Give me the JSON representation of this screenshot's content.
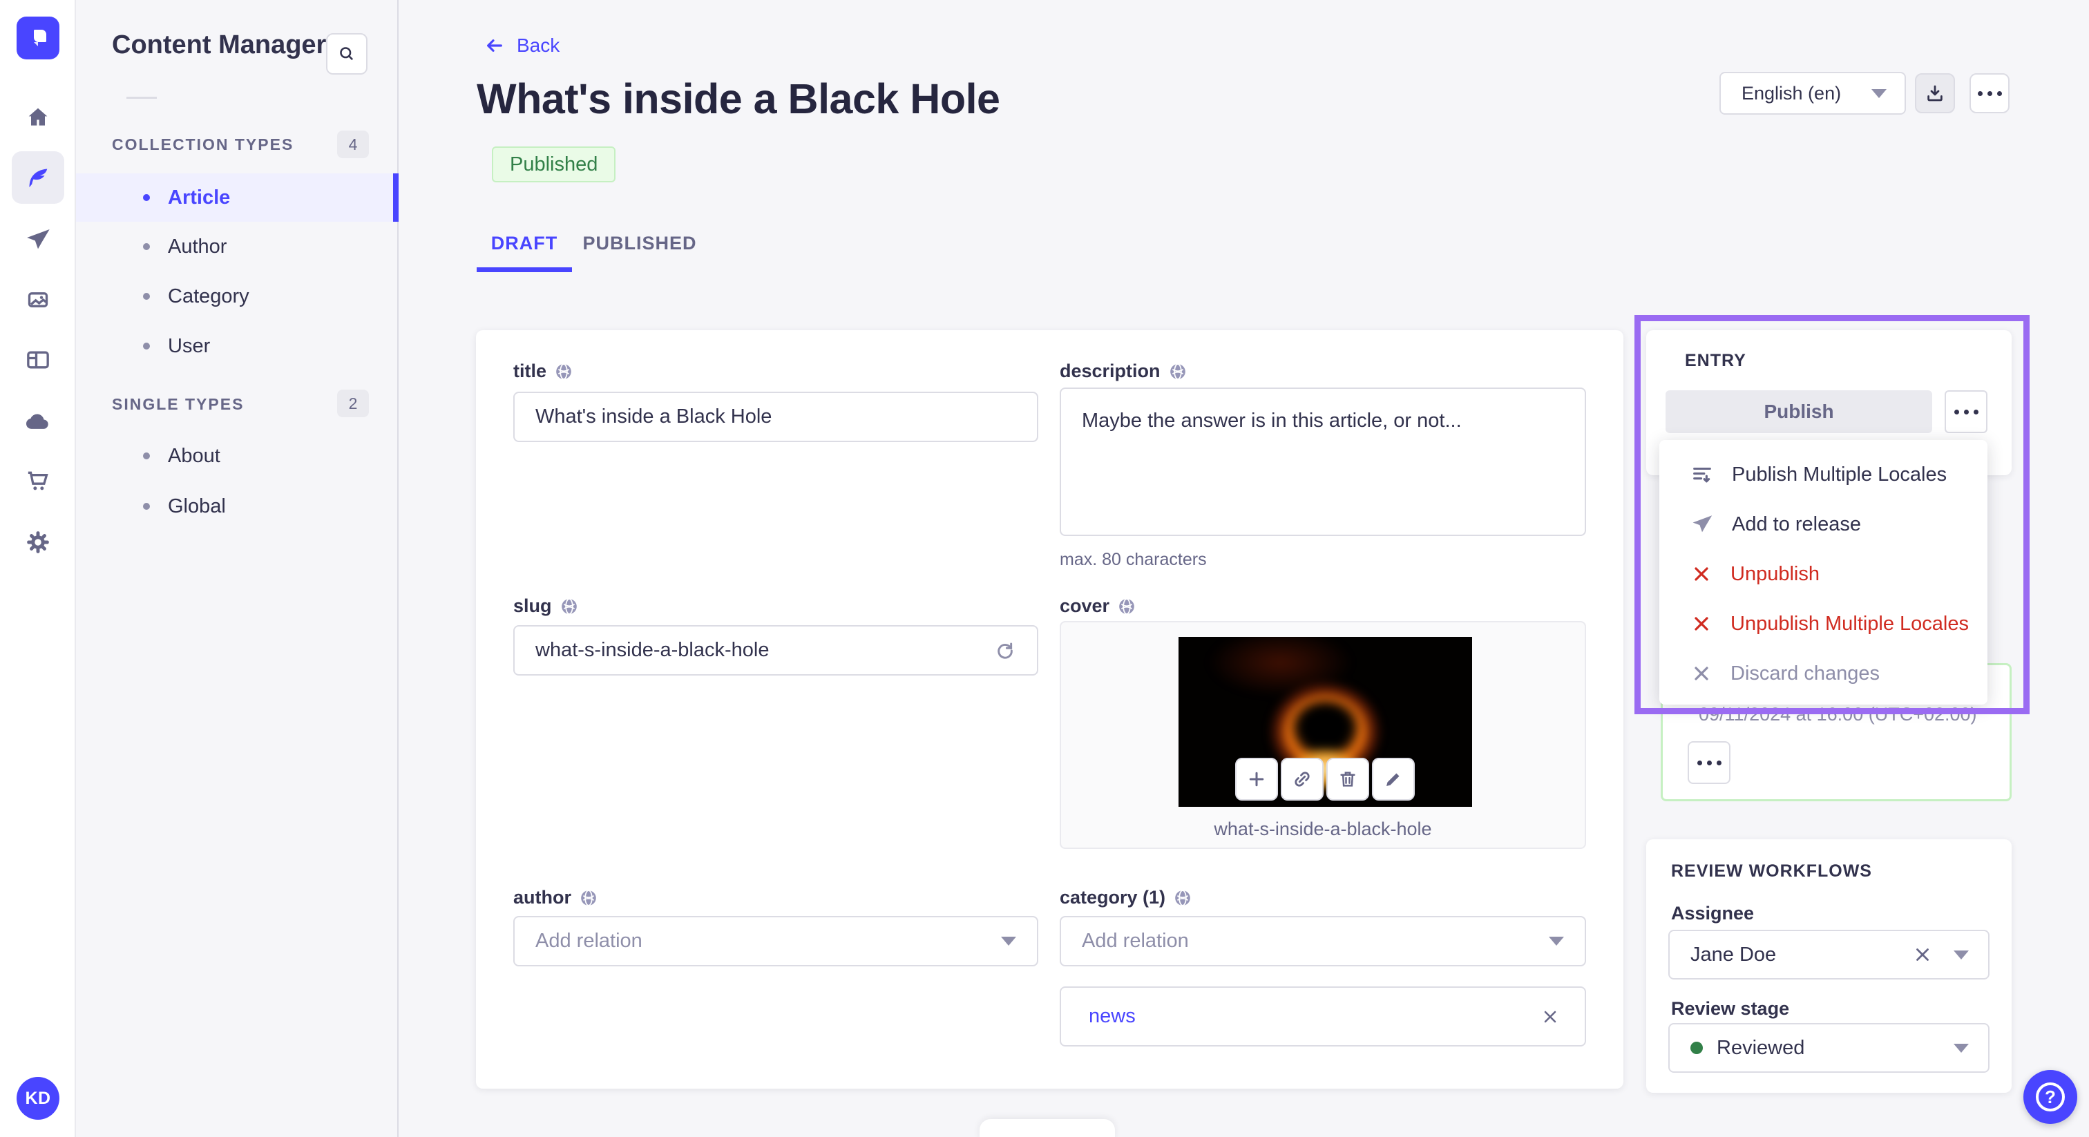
{
  "subnav": {
    "title": "Content Manager",
    "sections": [
      {
        "label": "COLLECTION TYPES",
        "count": "4",
        "items": [
          {
            "label": "Article"
          },
          {
            "label": "Author"
          },
          {
            "label": "Category"
          },
          {
            "label": "User"
          }
        ]
      },
      {
        "label": "SINGLE TYPES",
        "count": "2",
        "items": [
          {
            "label": "About"
          },
          {
            "label": "Global"
          }
        ]
      }
    ]
  },
  "header": {
    "back_label": "Back",
    "title": "What's inside a Black Hole",
    "status_badge": "Published",
    "locale_selected": "English (en)"
  },
  "tabs": {
    "draft": "DRAFT",
    "published": "PUBLISHED"
  },
  "form": {
    "title_field": {
      "label": "title",
      "value": "What's inside a Black Hole"
    },
    "description_field": {
      "label": "description",
      "value": "Maybe the answer is in this article, or not...",
      "hint": "max. 80 characters"
    },
    "slug_field": {
      "label": "slug",
      "value": "what-s-inside-a-black-hole"
    },
    "cover_field": {
      "label": "cover",
      "caption": "what-s-inside-a-black-hole"
    },
    "author_field": {
      "label": "author",
      "placeholder": "Add relation"
    },
    "category_field": {
      "label": "category (1)",
      "placeholder": "Add relation",
      "relation": "news"
    }
  },
  "entry_panel": {
    "title": "ENTRY",
    "publish_label": "Publish",
    "menu": [
      {
        "label": "Publish Multiple Locales"
      },
      {
        "label": "Add to release"
      },
      {
        "label": "Unpublish"
      },
      {
        "label": "Unpublish Multiple Locales"
      },
      {
        "label": "Discard changes"
      }
    ],
    "scheduled_date": "09/11/2024 at 16:00 (UTC+02:00)"
  },
  "review_panel": {
    "title": "REVIEW WORKFLOWS",
    "assignee_label": "Assignee",
    "assignee_value": "Jane Doe",
    "stage_label": "Review stage",
    "stage_value": "Reviewed"
  },
  "avatar": {
    "initials": "KD"
  },
  "icons": {
    "help_glyph": "?"
  },
  "colors": {
    "primary": "#4945ff",
    "danger": "#d02b20",
    "success_text": "#328048",
    "success_border": "#c6f0c2",
    "success_bg": "#eafbe7",
    "annotation": "#9a6bf2",
    "stage_dot": "#328048"
  }
}
